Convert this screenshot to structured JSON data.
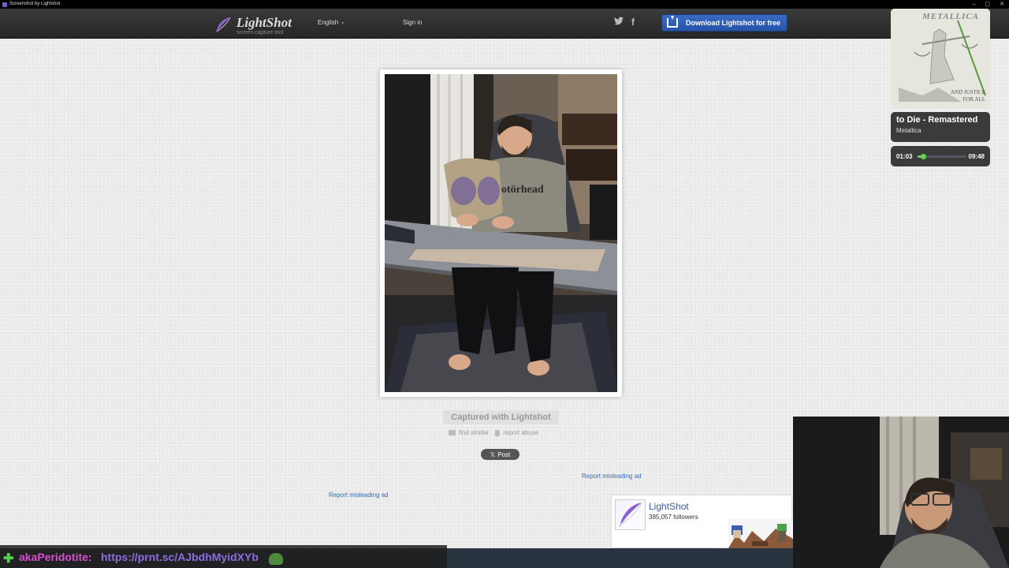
{
  "window": {
    "title": "Screenshot by Lightshot"
  },
  "header": {
    "brand": "LightShot",
    "tagline": "screen capture tool",
    "language": "English",
    "signin": "Sign in",
    "download": "Download Lightshot for free",
    "social": [
      {
        "icon": "twitter-icon"
      },
      {
        "icon": "facebook-icon"
      }
    ]
  },
  "main": {
    "captured": "Captured with Lightshot",
    "find_similar": "find similar",
    "report_abuse": "report abuse",
    "post": "Post",
    "report_ad_right": "Report misleading ad",
    "report_ad_left": "Report misleading ad"
  },
  "widget": {
    "name": "LightShot",
    "followers": "385,057 followers"
  },
  "music": {
    "album_band": "METALLICA",
    "album_title_line1": "AND JUSTICE",
    "album_title_line2": "FOR ALL",
    "track": "to Die - Remastered",
    "artist": "Metallica",
    "elapsed": "01:03",
    "total": "09:48",
    "progress": 0.11
  },
  "chat": {
    "username": "akaPeridotite:",
    "message": "https://prnt.sc/AJbdhMyidXYb"
  },
  "colors": {
    "download_button": "#2f5fb8",
    "link": "#3a6bb8",
    "progress": "#6ccf5a",
    "chat_user": "#d84dd1",
    "chat_url": "#8d6de0"
  }
}
